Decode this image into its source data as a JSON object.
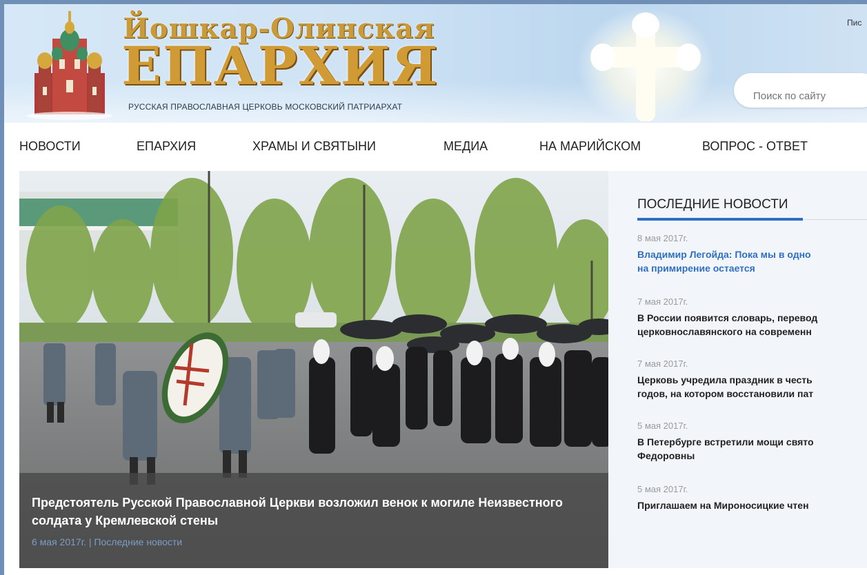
{
  "header": {
    "logo_line1": "Йошкар-Олинская",
    "logo_line2": "ЕПАРХИЯ",
    "logo_subtitle": "РУССКАЯ ПРАВОСЛАВНАЯ ЦЕРКОВЬ МОСКОВСКИЙ ПАТРИАРХАТ",
    "top_link": "Пис",
    "search_placeholder": "Поиск по сайту"
  },
  "nav": {
    "items": [
      "НОВОСТИ",
      "ЕПАРХИЯ",
      "ХРАМЫ И СВЯТЫНИ",
      "МЕДИА",
      "НА МАРИЙСКОМ",
      "ВОПРОС - ОТВЕТ"
    ]
  },
  "hero": {
    "title": "Предстоятель Русской Православной Церкви возложил венок к могиле Неизвестного солдата у Кремлевской стены",
    "date": "6 мая 2017г.",
    "separator": "|",
    "category": "Последние новости"
  },
  "sidebar": {
    "title": "ПОСЛЕДНИЕ НОВОСТИ",
    "news": [
      {
        "date": "8 мая 2017г.",
        "title_lines": [
          "Владимир Легойда: Пока мы в одно",
          "на примирение остается"
        ],
        "accent": true
      },
      {
        "date": "7 мая 2017г.",
        "title_lines": [
          "В России появится словарь, перевод",
          "церковнославянского на современн"
        ],
        "accent": false
      },
      {
        "date": "7 мая 2017г.",
        "title_lines": [
          "Церковь учредила праздник в честь",
          "годов, на котором восстановили пат"
        ],
        "accent": false
      },
      {
        "date": "5 мая 2017г.",
        "title_lines": [
          "В Петербурге встретили мощи свято",
          "Федоровны"
        ],
        "accent": false
      },
      {
        "date": "5 мая 2017г.",
        "title_lines": [
          "Приглашаем на Мироносицкие чтен"
        ],
        "accent": false
      }
    ]
  },
  "colors": {
    "accent": "#2f6fc1",
    "logo_gold": "#d09a35",
    "caption_bg": "#464646",
    "sidebar_bg": "#f2f6fb"
  }
}
